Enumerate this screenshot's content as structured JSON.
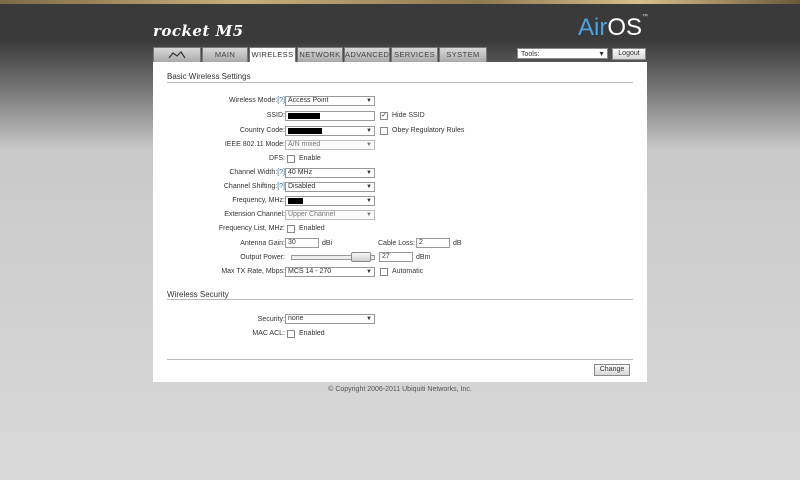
{
  "header": {
    "product_logo": "rocket M5",
    "os_logo_air": "Air",
    "os_logo_os": "OS",
    "os_logo_tm": "™",
    "tools_value": "Tools:",
    "logout_label": "Logout"
  },
  "tabs": [
    {
      "label": "MAIN"
    },
    {
      "label": "WIRELESS"
    },
    {
      "label": "NETWORK"
    },
    {
      "label": "ADVANCED"
    },
    {
      "label": "SERVICES"
    },
    {
      "label": "SYSTEM"
    }
  ],
  "active_tab": "WIRELESS",
  "basic": {
    "title": "Basic Wireless Settings",
    "wireless_mode": {
      "label": "Wireless Mode:",
      "help": "[?]",
      "value": "Access Point"
    },
    "ssid": {
      "label": "SSID:",
      "hide_label": "Hide SSID",
      "hide_checked": true
    },
    "country_code": {
      "label": "Country Code:",
      "obey_label": "Obey Regulatory Rules",
      "obey_checked": false
    },
    "ieee_mode": {
      "label": "IEEE 802.11 Mode:",
      "value": "A/N mixed"
    },
    "dfs": {
      "label": "DFS:",
      "enable_label": "Enable",
      "checked": false
    },
    "channel_width": {
      "label": "Channel Width:",
      "help": "[?]",
      "value": "40 MHz"
    },
    "channel_shifting": {
      "label": "Channel Shifting:",
      "help": "[?]",
      "value": "Disabled"
    },
    "frequency": {
      "label": "Frequency, MHz:"
    },
    "extension_channel": {
      "label": "Extension Channel:",
      "value": "Upper Channel"
    },
    "frequency_list": {
      "label": "Frequency List, MHz:",
      "enabled_label": "Enabled",
      "checked": false
    },
    "antenna_gain": {
      "label": "Antenna Gain:",
      "value": "30",
      "unit": "dBi"
    },
    "cable_loss": {
      "label": "Cable Loss:",
      "value": "2",
      "unit": "dB"
    },
    "output_power": {
      "label": "Output Power:",
      "value": "27",
      "unit": "dBm",
      "slider_fraction": 0.93
    },
    "max_tx_rate": {
      "label": "Max TX Rate, Mbps:",
      "value": "MCS 14 - 270",
      "auto_label": "Automatic",
      "auto_checked": false
    }
  },
  "security": {
    "title": "Wireless Security",
    "security": {
      "label": "Security:",
      "value": "none"
    },
    "mac_acl": {
      "label": "MAC ACL:",
      "enabled_label": "Enabled",
      "checked": false
    }
  },
  "change_label": "Change",
  "footer": {
    "copyright": "© Copyright 2006-2011 Ubiquiti Networks, Inc."
  }
}
